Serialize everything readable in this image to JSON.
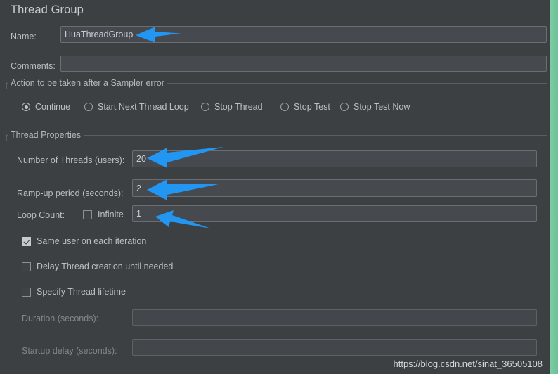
{
  "window": {
    "title": "Thread Group",
    "background_color": "#3c4043",
    "accent_color": "#2196f3",
    "edge_strip_color": "#74c79c"
  },
  "name_row": {
    "label": "Name:",
    "value": "HuaThreadGroup",
    "placeholder": ""
  },
  "comments_row": {
    "label": "Comments:",
    "value": "",
    "placeholder": ""
  },
  "sampler_error_group": {
    "title": "Action to be taken after a Sampler error",
    "options": [
      {
        "label": "Continue",
        "selected": true
      },
      {
        "label": "Start Next Thread Loop",
        "selected": false
      },
      {
        "label": "Stop Thread",
        "selected": false
      },
      {
        "label": "Stop Test",
        "selected": false
      },
      {
        "label": "Stop Test Now",
        "selected": false
      }
    ]
  },
  "thread_properties_group": {
    "title": "Thread Properties",
    "number_of_threads": {
      "label": "Number of Threads (users):",
      "value": "20"
    },
    "ramp_up_period": {
      "label": "Ramp-up period (seconds):",
      "value": "2"
    },
    "loop_count": {
      "label": "Loop Count:",
      "infinite_label": "Infinite",
      "infinite_checked": false,
      "value": "1"
    },
    "checkboxes": [
      {
        "label": "Same user on each iteration",
        "checked": true
      },
      {
        "label": "Delay Thread creation until needed",
        "checked": false
      },
      {
        "label": "Specify Thread lifetime",
        "checked": false
      }
    ],
    "duration": {
      "label": "Duration (seconds):",
      "value": "",
      "disabled": true
    },
    "startup_delay": {
      "label": "Startup delay (seconds):",
      "value": "",
      "disabled": true
    }
  },
  "annotations": {
    "arrow_color": "#2196f3",
    "arrows": [
      {
        "name": "arrow-to-name-field"
      },
      {
        "name": "arrow-to-number-of-threads"
      },
      {
        "name": "arrow-to-ramp-up-period"
      },
      {
        "name": "arrow-to-loop-count"
      }
    ]
  },
  "watermark": {
    "text": "https://blog.csdn.net/sinat_36505108"
  }
}
